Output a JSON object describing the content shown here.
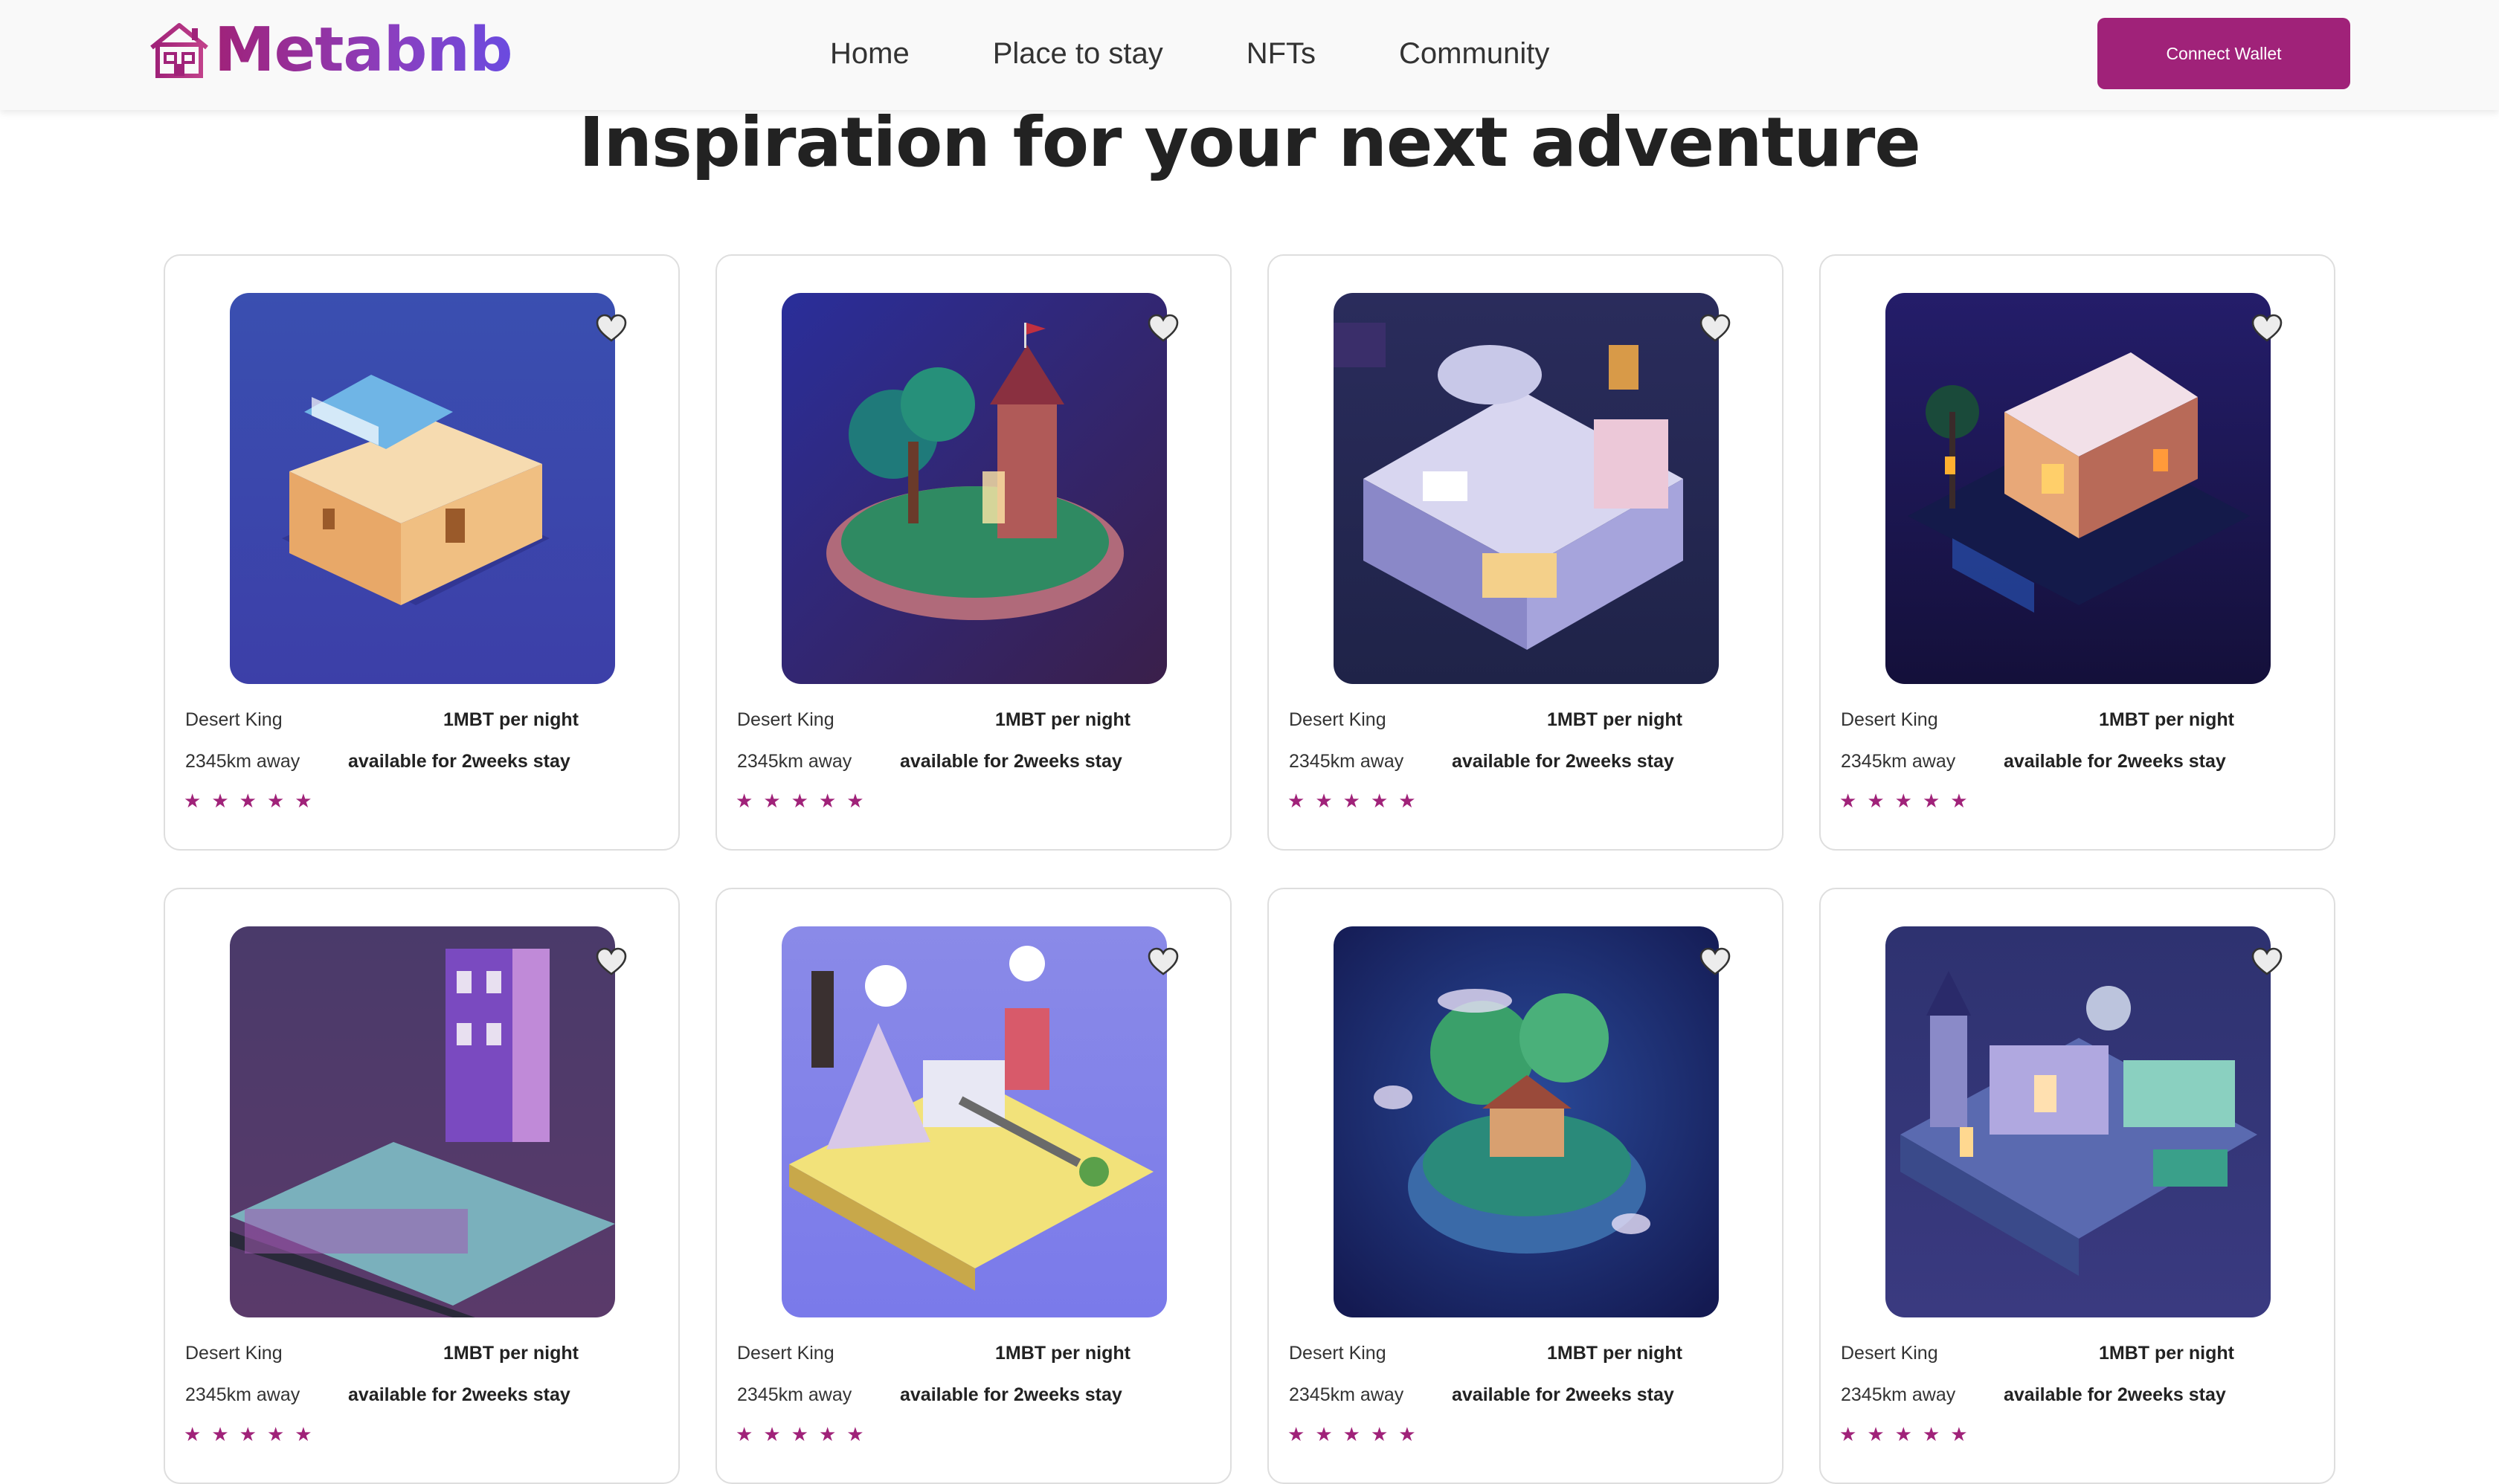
{
  "navbar": {
    "logo_text": "Metabnb",
    "links": [
      "Home",
      "Place to stay",
      "NFTs",
      "Community"
    ],
    "connect_label": "Connect Wallet",
    "brand_color": "#a02279"
  },
  "page": {
    "title": "Inspiration for your next adventure"
  },
  "icons": {
    "favorite": "heart-icon",
    "rating": "star-icon",
    "logo": "house-icon"
  },
  "listings": [
    {
      "name": "Desert King",
      "price": "1MBT per night",
      "distance": "2345km away",
      "availability": "available for 2weeks stay",
      "rating": 5,
      "image": "desert-house"
    },
    {
      "name": "Desert King",
      "price": "1MBT per night",
      "distance": "2345km away",
      "availability": "available for 2weeks stay",
      "rating": 5,
      "image": "castle-island"
    },
    {
      "name": "Desert King",
      "price": "1MBT per night",
      "distance": "2345km away",
      "availability": "available for 2weeks stay",
      "rating": 5,
      "image": "dome-house"
    },
    {
      "name": "Desert King",
      "price": "1MBT per night",
      "distance": "2345km away",
      "availability": "available for 2weeks stay",
      "rating": 5,
      "image": "night-villa"
    },
    {
      "name": "Desert King",
      "price": "1MBT per night",
      "distance": "2345km away",
      "availability": "available for 2weeks stay",
      "rating": 5,
      "image": "purple-tower"
    },
    {
      "name": "Desert King",
      "price": "1MBT per night",
      "distance": "2345km away",
      "availability": "available for 2weeks stay",
      "rating": 5,
      "image": "mini-city"
    },
    {
      "name": "Desert King",
      "price": "1MBT per night",
      "distance": "2345km away",
      "availability": "available for 2weeks stay",
      "rating": 5,
      "image": "floating-island"
    },
    {
      "name": "Desert King",
      "price": "1MBT per night",
      "distance": "2345km away",
      "availability": "available for 2weeks stay",
      "rating": 5,
      "image": "fantasy-town"
    }
  ]
}
